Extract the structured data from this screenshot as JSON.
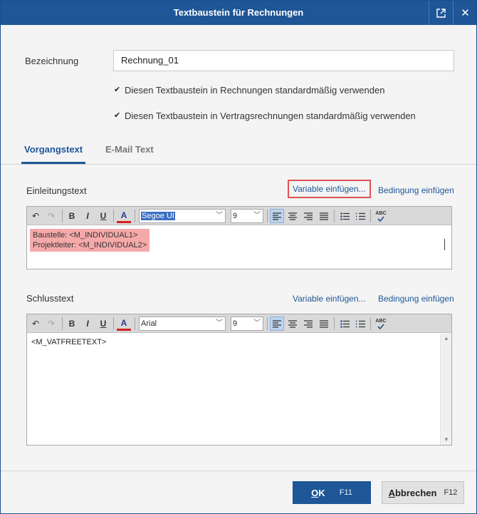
{
  "window": {
    "title": "Textbaustein für Rechnungen"
  },
  "form": {
    "name_label": "Bezeichnung",
    "name_value": "Rechnung_01",
    "checkbox1_label": "Diesen Textbaustein in Rechnungen standardmäßig verwenden",
    "checkbox2_label": "Diesen Textbaustein in Vertragsrechnungen standardmäßig verwenden",
    "checkbox1_checked": true,
    "checkbox2_checked": true
  },
  "tabs": [
    {
      "label": "Vorgangstext",
      "active": true
    },
    {
      "label": "E-Mail Text",
      "active": false
    }
  ],
  "intro": {
    "label": "Einleitungstext",
    "variable_link": "Variable einfügen...",
    "condition_link": "Bedingung einfügen",
    "font": "Segoe UI",
    "size": "9",
    "lines": [
      "Baustelle: <M_INDIVIDUAL1>",
      "Projektleiter: <M_INDIVIDUAL2>"
    ]
  },
  "closing": {
    "label": "Schlusstext",
    "variable_link": "Variable einfügen...",
    "condition_link": "Bedingung einfügen",
    "font": "Arial",
    "size": "9",
    "text": "<M_VATFREETEXT>"
  },
  "footer": {
    "ok_mnemonic": "O",
    "ok_rest": "K",
    "ok_key": "F11",
    "cancel_mnemonic": "A",
    "cancel_rest": "bbrechen",
    "cancel_key": "F12"
  },
  "toolbar_icons": {
    "undo": "↶",
    "redo": "↷",
    "bold": "B",
    "italic": "I",
    "underline": "U",
    "font_color": "A",
    "spell": "ABC"
  },
  "colors": {
    "accent": "#1e5697",
    "highlight_text_bg": "#f5a9a9",
    "highlight_border": "#e05252"
  }
}
